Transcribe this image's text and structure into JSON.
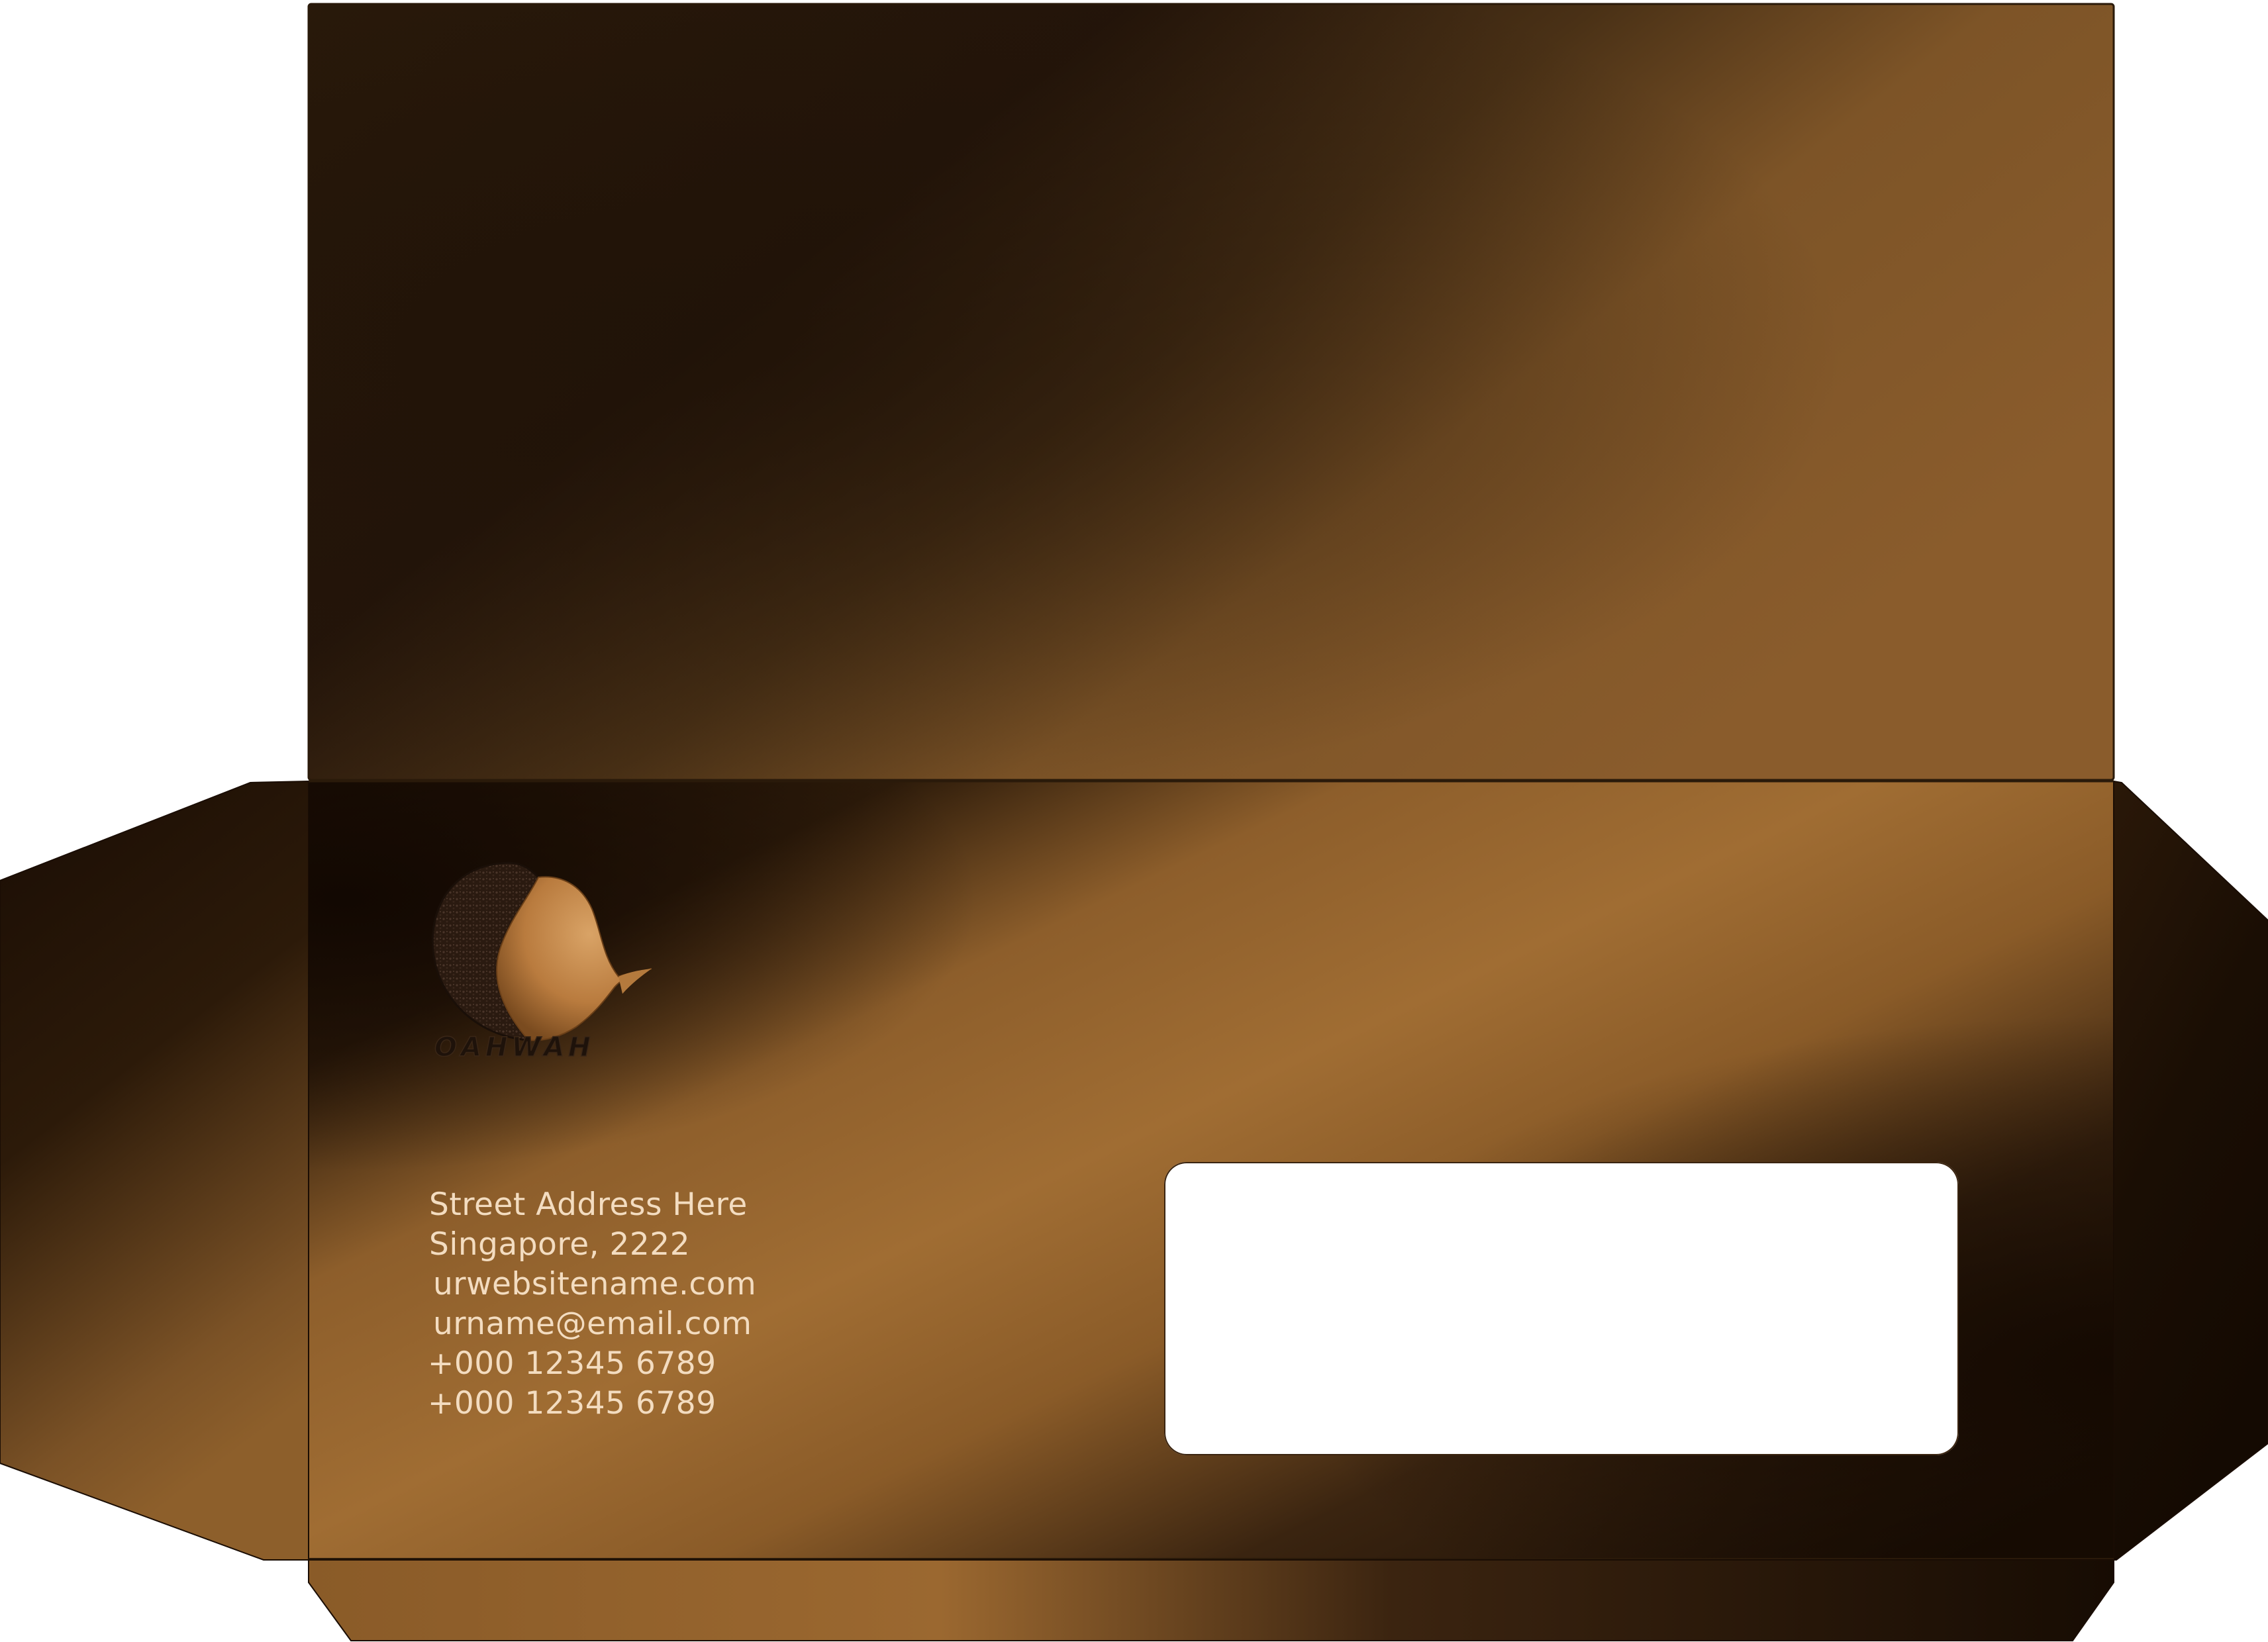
{
  "brand": {
    "logo_text": "OAHWAH",
    "logo_icon": "coffee-bean-swirl-icon"
  },
  "contact": {
    "street": "Street Address Here",
    "city": "Singapore, 2222",
    "website": "urwebsitename.com",
    "email": "urname@email.com",
    "phone_1": "+000 12345 6789",
    "phone_2": "+000 12345 6789"
  },
  "colors": {
    "dark_brown": "#1e1105",
    "mid_brown": "#5a3a18",
    "light_brown": "#a06d33",
    "text": "#f3dcc0",
    "window": "#ffffff"
  }
}
